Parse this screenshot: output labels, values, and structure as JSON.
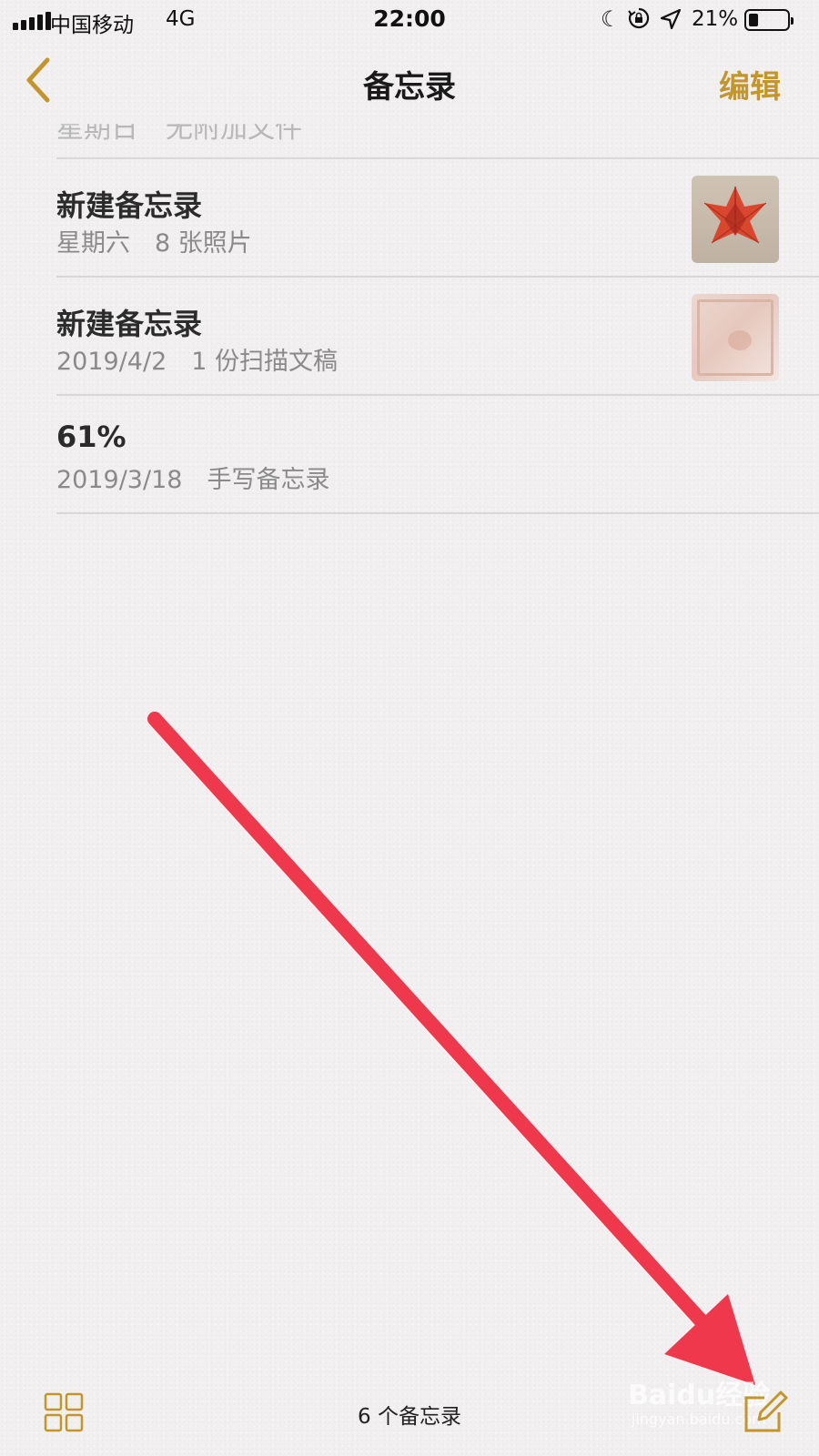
{
  "status_bar": {
    "carrier": "中国移动",
    "network": "4G",
    "time": "22:00",
    "battery_percent": "21%",
    "battery_level": 0.21,
    "icons": [
      "signal-icon",
      "moon-icon",
      "rotation-lock-icon",
      "location-icon",
      "battery-icon"
    ]
  },
  "nav": {
    "title": "备忘录",
    "edit_label": "编辑",
    "back_icon": "chevron-left-icon"
  },
  "notes": {
    "partial_row": "星期日　无附加文件",
    "items": [
      {
        "title": "新建备忘录",
        "date": "星期六",
        "detail": "8 张照片",
        "thumbnail": "red-origami-photo"
      },
      {
        "title": "新建备忘录",
        "date": "2019/4/2",
        "detail": "1 份扫描文稿",
        "thumbnail": "scanned-document"
      },
      {
        "title": "61%",
        "date": "2019/3/18",
        "detail": "手写备忘录"
      }
    ]
  },
  "toolbar": {
    "count_label": "6 个备忘录",
    "gallery_icon": "gallery-grid-icon",
    "compose_icon": "compose-icon"
  },
  "watermark": {
    "text": "Baidu经验",
    "sub": "jingyan.baidu.com"
  },
  "colors": {
    "accent": "#c3962c",
    "background": "#f1eff0",
    "annotation": "#f0384d"
  }
}
